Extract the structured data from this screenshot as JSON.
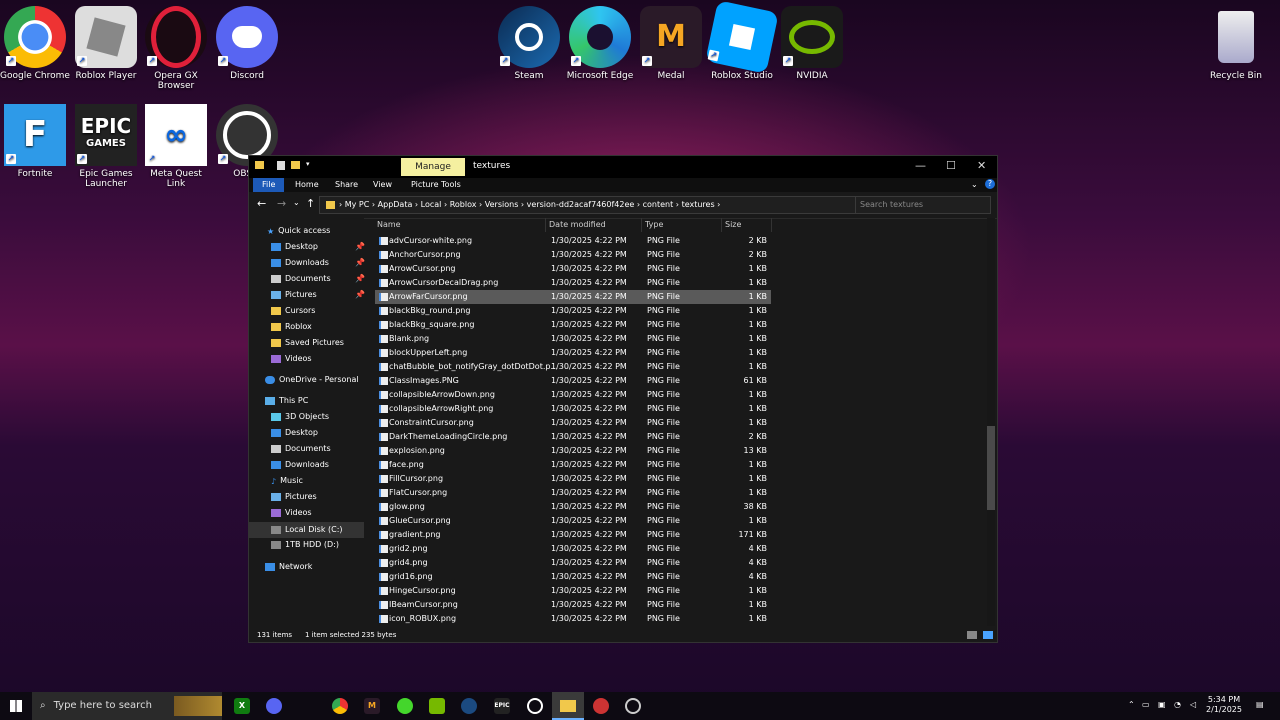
{
  "desktop": {
    "icons": [
      {
        "label": "Google Chrome"
      },
      {
        "label": "Roblox Player"
      },
      {
        "label": "Opera GX Browser"
      },
      {
        "label": "Discord"
      },
      {
        "label": "Steam"
      },
      {
        "label": "Microsoft Edge"
      },
      {
        "label": "Medal"
      },
      {
        "label": "Roblox Studio"
      },
      {
        "label": "NVIDIA"
      },
      {
        "label": "Recycle Bin"
      },
      {
        "label": "Fortnite"
      },
      {
        "label": "Epic Games Launcher"
      },
      {
        "label": "Meta Quest Link"
      },
      {
        "label": "OBS S"
      }
    ],
    "glyphs": {
      "epic": "EPIC",
      "epic2": "GAMES",
      "fortnite": "F"
    }
  },
  "explorer": {
    "title": "textures",
    "manage_tab": "Manage",
    "ribbon": [
      "File",
      "Home",
      "Share",
      "View",
      "Picture Tools"
    ],
    "breadcrumb": [
      "My PC",
      "AppData",
      "Local",
      "Roblox",
      "Versions",
      "version-dd2acaf7460f42ee",
      "content",
      "textures"
    ],
    "search_placeholder": "Search textures",
    "nav": {
      "quick_access": "Quick access",
      "items": [
        "Desktop",
        "Downloads",
        "Documents",
        "Pictures",
        "Cursors",
        "Roblox",
        "Saved Pictures",
        "Videos"
      ],
      "onedrive": "OneDrive - Personal",
      "this_pc": "This PC",
      "pc_items": [
        "3D Objects",
        "Desktop",
        "Documents",
        "Downloads",
        "Music",
        "Pictures",
        "Videos",
        "Local Disk (C:)",
        "1TB HDD (D:)"
      ],
      "network": "Network"
    },
    "columns": [
      "Name",
      "Date modified",
      "Type",
      "Size"
    ],
    "files": [
      [
        "advCursor-white.png",
        "1/30/2025 4:22 PM",
        "PNG File",
        "2 KB"
      ],
      [
        "AnchorCursor.png",
        "1/30/2025 4:22 PM",
        "PNG File",
        "2 KB"
      ],
      [
        "ArrowCursor.png",
        "1/30/2025 4:22 PM",
        "PNG File",
        "1 KB"
      ],
      [
        "ArrowCursorDecalDrag.png",
        "1/30/2025 4:22 PM",
        "PNG File",
        "1 KB"
      ],
      [
        "ArrowFarCursor.png",
        "1/30/2025 4:22 PM",
        "PNG File",
        "1 KB"
      ],
      [
        "blackBkg_round.png",
        "1/30/2025 4:22 PM",
        "PNG File",
        "1 KB"
      ],
      [
        "blackBkg_square.png",
        "1/30/2025 4:22 PM",
        "PNG File",
        "1 KB"
      ],
      [
        "Blank.png",
        "1/30/2025 4:22 PM",
        "PNG File",
        "1 KB"
      ],
      [
        "blockUpperLeft.png",
        "1/30/2025 4:22 PM",
        "PNG File",
        "1 KB"
      ],
      [
        "chatBubble_bot_notifyGray_dotDotDot.p...",
        "1/30/2025 4:22 PM",
        "PNG File",
        "1 KB"
      ],
      [
        "ClassImages.PNG",
        "1/30/2025 4:22 PM",
        "PNG File",
        "61 KB"
      ],
      [
        "collapsibleArrowDown.png",
        "1/30/2025 4:22 PM",
        "PNG File",
        "1 KB"
      ],
      [
        "collapsibleArrowRight.png",
        "1/30/2025 4:22 PM",
        "PNG File",
        "1 KB"
      ],
      [
        "ConstraintCursor.png",
        "1/30/2025 4:22 PM",
        "PNG File",
        "1 KB"
      ],
      [
        "DarkThemeLoadingCircle.png",
        "1/30/2025 4:22 PM",
        "PNG File",
        "2 KB"
      ],
      [
        "explosion.png",
        "1/30/2025 4:22 PM",
        "PNG File",
        "13 KB"
      ],
      [
        "face.png",
        "1/30/2025 4:22 PM",
        "PNG File",
        "1 KB"
      ],
      [
        "FillCursor.png",
        "1/30/2025 4:22 PM",
        "PNG File",
        "1 KB"
      ],
      [
        "FlatCursor.png",
        "1/30/2025 4:22 PM",
        "PNG File",
        "1 KB"
      ],
      [
        "glow.png",
        "1/30/2025 4:22 PM",
        "PNG File",
        "38 KB"
      ],
      [
        "GlueCursor.png",
        "1/30/2025 4:22 PM",
        "PNG File",
        "1 KB"
      ],
      [
        "gradient.png",
        "1/30/2025 4:22 PM",
        "PNG File",
        "171 KB"
      ],
      [
        "grid2.png",
        "1/30/2025 4:22 PM",
        "PNG File",
        "4 KB"
      ],
      [
        "grid4.png",
        "1/30/2025 4:22 PM",
        "PNG File",
        "4 KB"
      ],
      [
        "grid16.png",
        "1/30/2025 4:22 PM",
        "PNG File",
        "4 KB"
      ],
      [
        "HingeCursor.png",
        "1/30/2025 4:22 PM",
        "PNG File",
        "1 KB"
      ],
      [
        "IBeamCursor.png",
        "1/30/2025 4:22 PM",
        "PNG File",
        "1 KB"
      ],
      [
        "icon_ROBUX.png",
        "1/30/2025 4:22 PM",
        "PNG File",
        "1 KB"
      ]
    ],
    "selected_index": 4,
    "status_count": "131 items",
    "status_selected": "1 item selected  235 bytes"
  },
  "taskbar": {
    "search_placeholder": "Type here to search",
    "epic_glyph": "EPIC",
    "time": "5:34 PM",
    "date": "2/1/2025"
  }
}
